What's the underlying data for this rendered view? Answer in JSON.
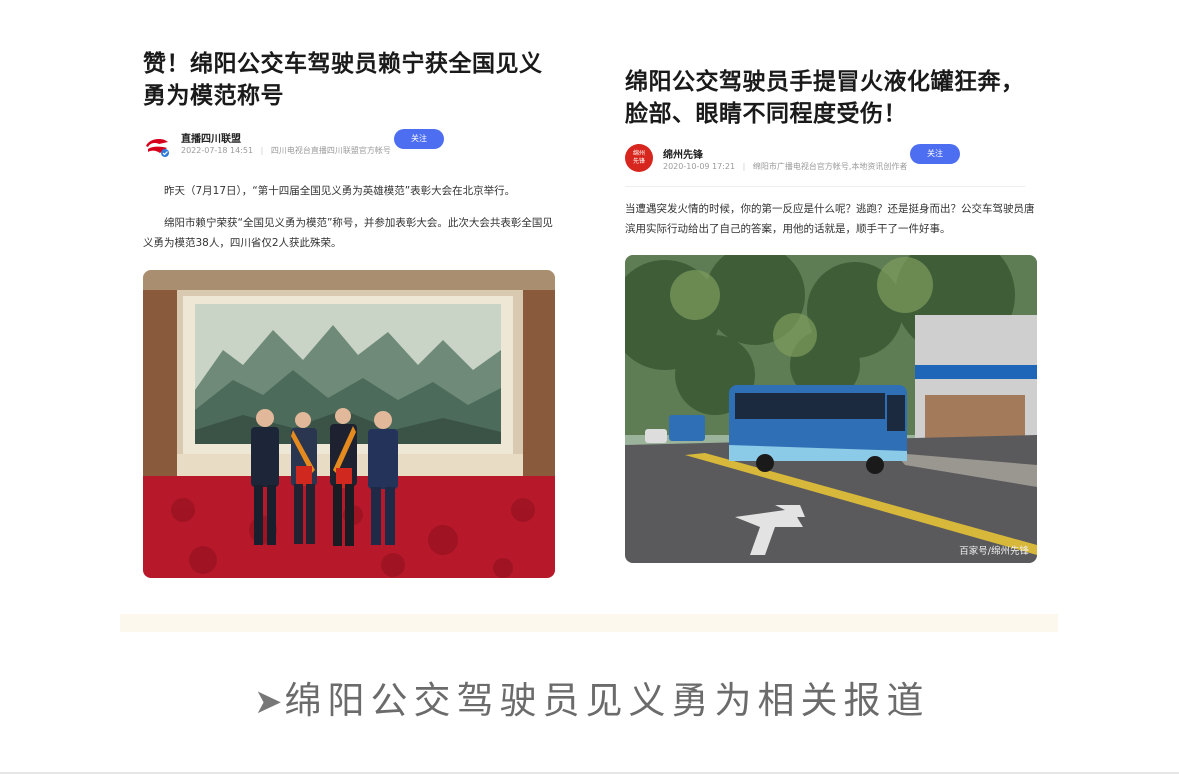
{
  "left_article": {
    "headline": "赞！绵阳公交车驾驶员赖宁获全国见义勇为模范称号",
    "source_name": "直播四川联盟",
    "source_date": "2022-07-18 14:51",
    "source_desc": "四川电视台直播四川联盟官方帐号",
    "follow_label": "关注",
    "paragraphs": [
      "昨天（7月17日），“第十四届全国见义勇为英雄模范”表彰大会在北京举行。",
      "绵阳市赖宁荣获“全国见义勇为模范”称号，并参加表彰大会。此次大会共表彰全国见义勇为模范38人，四川省仅2人获此殊荣。"
    ]
  },
  "right_article": {
    "headline": "绵阳公交驾驶员手提冒火液化罐狂奔，脸部、眼睛不同程度受伤！",
    "source_name": "绵州先锋",
    "source_logo_text": "绵州先锋",
    "source_date": "2020-10-09 17:21",
    "source_desc": "绵阳市广播电视台官方帐号,本地资讯创作者",
    "follow_label": "关注",
    "paragraph": "当遭遇突发火情的时候，你的第一反应是什么呢？逃跑？还是挺身而出？公交车驾驶员唐滨用实际行动给出了自己的答案，用他的话就是，顺手干了一件好事。",
    "photo_watermark": "百家号/绵州先锋"
  },
  "footer": {
    "arrow": "➤",
    "caption": "绵阳公交驾驶员见义勇为相关报道"
  },
  "colors": {
    "follow_button": "#4e6ef2",
    "carpet": "#b8192a",
    "bottom_band": "#fdf8ee"
  }
}
